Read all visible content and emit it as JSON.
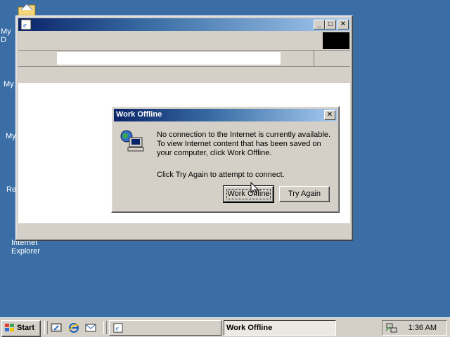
{
  "desktop": {
    "icons": [
      {
        "label": "My D",
        "icon": "my-documents-icon"
      },
      {
        "label": "My",
        "icon": "my-computer-icon"
      },
      {
        "label": "My",
        "icon": "my-network-places-icon"
      },
      {
        "label": "Re",
        "icon": "recycle-bin-icon"
      },
      {
        "label_line1": "Internet",
        "label_line2": "Explorer",
        "icon": "internet-explorer-icon"
      }
    ],
    "background_color": "#3a6ea5"
  },
  "browser_window": {
    "title": "",
    "controls": {
      "minimize": "_",
      "maximize": "□",
      "close": "✕"
    }
  },
  "dialog": {
    "title": "Work Offline",
    "message_line1": "No connection to the Internet is currently available.",
    "message_line2": "To view Internet content that has been saved on",
    "message_line3": "your computer, click Work Offline.",
    "message_line4": "Click Try Again to attempt to connect.",
    "work_offline_label": "Work Offline",
    "try_again_label": "Try Again",
    "close_glyph": "✕"
  },
  "taskbar": {
    "start_label": "Start",
    "active_task_label": "Work Offline",
    "clock": "1:36 AM"
  },
  "colors": {
    "title_active": "#0a246a",
    "face": "#d4d0c8"
  }
}
